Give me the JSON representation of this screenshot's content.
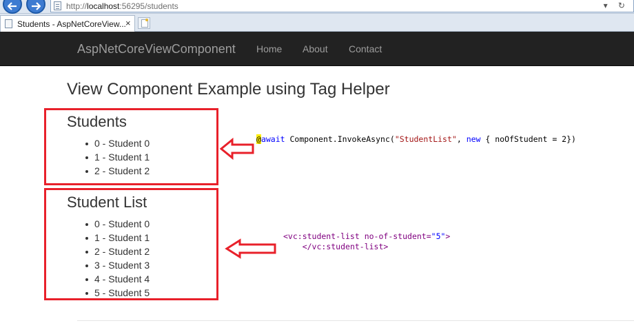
{
  "browser": {
    "url_prefix": "http://",
    "url_host": "localhost",
    "url_rest": ":56295/students",
    "tab_title": "Students - AspNetCoreView...",
    "tab_close": "×",
    "url_actions": "▾ ↻"
  },
  "navbar": {
    "brand": "AspNetCoreViewComponent",
    "links": [
      "Home",
      "About",
      "Contact"
    ]
  },
  "page": {
    "heading": "View Component Example using Tag Helper",
    "sections": [
      {
        "title": "Students",
        "items": [
          "0 - Student 0",
          "1 - Student 1",
          "2 - Student 2"
        ]
      },
      {
        "title": "Student List",
        "items": [
          "0 - Student 0",
          "1 - Student 1",
          "2 - Student 2",
          "3 - Student 3",
          "4 - Student 4",
          "5 - Student 5"
        ]
      }
    ]
  },
  "annotations": {
    "code_a": {
      "at": "@",
      "await": "await",
      "call": " Component.InvokeAsync(",
      "string": "\"StudentList\"",
      "comma": ", ",
      "new": "new",
      "rest": " { noOfStudent = 2})"
    },
    "code_b": {
      "open_tag": "<vc:student-list",
      "attr": " no-of-student=",
      "value": "\"5\"",
      "close_bracket": ">",
      "close_tag": "</vc:student-list>"
    },
    "box_color": "#e8202a"
  }
}
